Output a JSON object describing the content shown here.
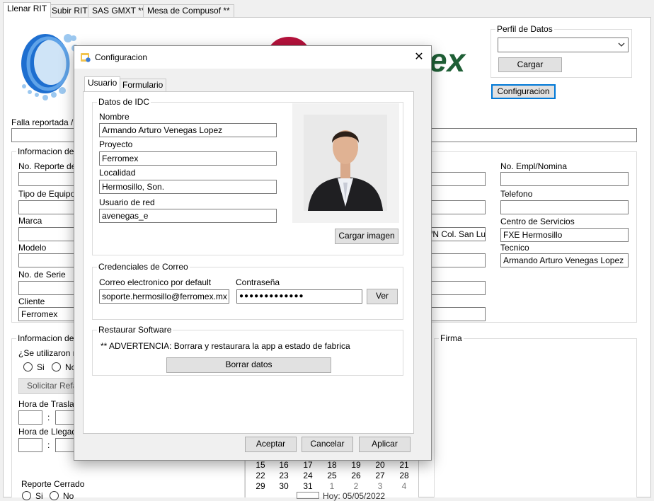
{
  "main_tabs": [
    {
      "label": "Llenar RIT",
      "active": true
    },
    {
      "label": "Subir RIT",
      "active": false
    },
    {
      "label": "SAS GMXT **",
      "active": false
    },
    {
      "label": "Mesa de Compusof **",
      "active": false
    }
  ],
  "logo_text": "ex",
  "perfil": {
    "title": "Perfil de Datos",
    "select_value": "",
    "cargar_label": "Cargar",
    "configuracion_label": "Configuracion"
  },
  "falla_label": "Falla reportada / T",
  "info_group": {
    "title": "Informacion del R",
    "fields": {
      "no_reporte": "No. Reporte del",
      "tipo_equipo": "Tipo de Equipo",
      "marca": "Marca",
      "modelo": "Modelo",
      "no_serie": "No. de Serie",
      "cliente": "Cliente"
    },
    "cliente_value": "Ferromex",
    "middle_partial_value": "S/N Col. San Lu",
    "right": {
      "no_empl_label": "No. Empl/Nomina",
      "no_empl_value": "",
      "telefono_label": "Telefono",
      "telefono_value": "",
      "centro_label": "Centro de Servicios",
      "centro_value": "FXE Hermosillo",
      "tecnico_label": "Tecnico",
      "tecnico_value": "Armando Arturo Venegas Lopez"
    }
  },
  "info_t_group": {
    "title": "Informacion del T",
    "question": "¿Se utilizaron ref",
    "si": "Si",
    "no": "No",
    "solicitar": "Solicitar Refac",
    "hora_traslado": "Hora de Traslado",
    "hora_llegada": "Hora de Llegada",
    "colon": ":",
    "reporte_cerrado": "Reporte Cerrado",
    "rc_si": "Si",
    "rc_no": "No"
  },
  "firma_title": "Firma",
  "calendar": {
    "rows": [
      [
        "15",
        "16",
        "17",
        "18",
        "19",
        "20",
        "21"
      ],
      [
        "22",
        "23",
        "24",
        "25",
        "26",
        "27",
        "28"
      ],
      [
        "29",
        "30",
        "31",
        "1",
        "2",
        "3",
        "4"
      ]
    ],
    "today": "Hoy: 05/05/2022"
  },
  "dialog": {
    "title": "Configuracion",
    "close_glyph": "✕",
    "tabs": [
      "Usuario",
      "Formulario"
    ],
    "idc": {
      "title": "Datos de IDC",
      "nombre_label": "Nombre",
      "nombre_value": "Armando Arturo Venegas Lopez",
      "proyecto_label": "Proyecto",
      "proyecto_value": "Ferromex",
      "localidad_label": "Localidad",
      "localidad_value": "Hermosillo, Son.",
      "usuario_label": "Usuario de red",
      "usuario_value": "avenegas_e",
      "cargar_imagen": "Cargar imagen"
    },
    "correo": {
      "title": "Credenciales de Correo",
      "email_label": "Correo electronico por default",
      "email_value": "soporte.hermosillo@ferromex.mx",
      "password_label": "Contraseña",
      "password_value": "●●●●●●●●●●●●●",
      "ver_label": "Ver"
    },
    "restaurar": {
      "title": "Restaurar Software",
      "warning": "** ADVERTENCIA: Borrara y restaurara la app a estado de fabrica",
      "borrar_label": "Borrar datos"
    },
    "aceptar": "Aceptar",
    "cancelar": "Cancelar",
    "aplicar": "Aplicar"
  }
}
